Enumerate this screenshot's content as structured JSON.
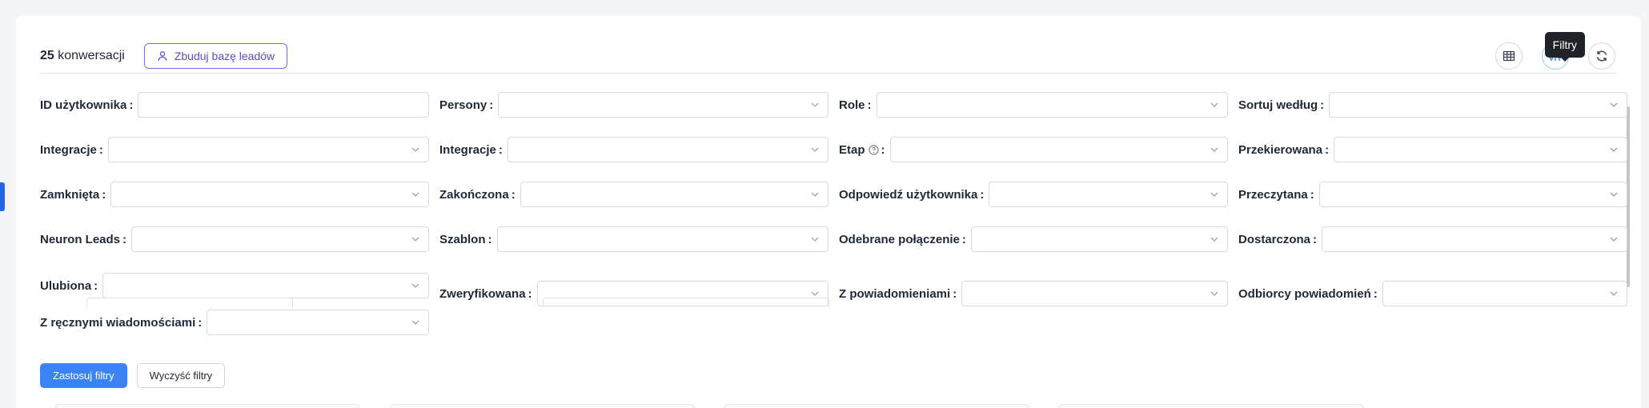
{
  "header": {
    "count_value": "25",
    "count_label": "konwersacji",
    "build_leads_label": "Zbuduj bazę leadów",
    "tooltip": "Filtry"
  },
  "filters": [
    {
      "label": "ID użytkownika",
      "type": "text"
    },
    {
      "label": "Persony",
      "type": "select"
    },
    {
      "label": "Role",
      "type": "select"
    },
    {
      "label": "Sortuj według",
      "type": "select"
    },
    {
      "label": "Integracje",
      "type": "select"
    },
    {
      "label": "Integracje",
      "type": "select"
    },
    {
      "label": "Etap",
      "type": "select",
      "info": true
    },
    {
      "label": "Przekierowana",
      "type": "select"
    },
    {
      "label": "Zamknięta",
      "type": "select"
    },
    {
      "label": "Zakończona",
      "type": "select"
    },
    {
      "label": "Odpowiedź użytkownika",
      "type": "select"
    },
    {
      "label": "Przeczytana",
      "type": "select"
    },
    {
      "label": "Neuron Leads",
      "type": "select"
    },
    {
      "label": "Szablon",
      "type": "select"
    },
    {
      "label": "Odebrane połączenie",
      "type": "select"
    },
    {
      "label": "Dostarczona",
      "type": "select"
    },
    {
      "label": "Ulubiona",
      "type": "select"
    },
    {
      "label": "Zweryfikowana",
      "type": "select"
    },
    {
      "label": "Z powiadomieniami",
      "type": "select"
    },
    {
      "label": "Odbiorcy powiadomień",
      "type": "select"
    },
    {
      "label": "Z ręcznymi wiadomościami",
      "type": "select"
    }
  ],
  "actions": {
    "apply": "Zastosuj filtry",
    "clear": "Wyczyść filtry"
  },
  "colors": {
    "primary": "#3b82f6",
    "accent_purple": "#5b4bc4"
  }
}
